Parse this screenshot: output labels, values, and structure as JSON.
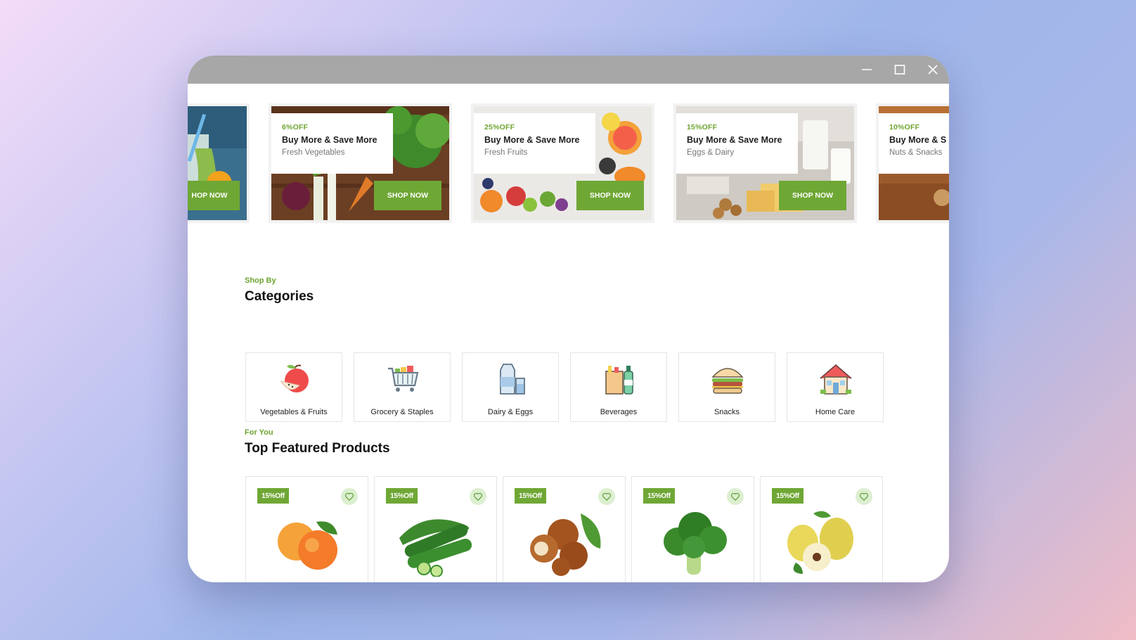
{
  "window": {
    "controls": {
      "minimize": "minimize-icon",
      "maximize": "maximize-icon",
      "close": "close-icon"
    }
  },
  "banners": [
    {
      "off": "",
      "title": "",
      "subtitle": "",
      "button": "SHOP NOW",
      "button_visible": "HOP NOW"
    },
    {
      "off": "6%OFF",
      "title": "Buy More & Save More",
      "subtitle": "Fresh Vegetables",
      "button": "SHOP NOW"
    },
    {
      "off": "25%OFF",
      "title": "Buy More & Save More",
      "subtitle": "Fresh Fruits",
      "button": "SHOP NOW"
    },
    {
      "off": "15%OFF",
      "title": "Buy More & Save More",
      "subtitle": "Eggs & Dairy",
      "button": "SHOP NOW"
    },
    {
      "off": "10%OFF",
      "title": "Buy More & S",
      "subtitle": "Nuts & Snacks",
      "button": ""
    }
  ],
  "categories_section": {
    "kicker": "Shop By",
    "title": "Categories",
    "items": [
      {
        "label": "Vegetables & Fruits",
        "icon": "apple-icon"
      },
      {
        "label": "Grocery & Staples",
        "icon": "shopping-cart-icon"
      },
      {
        "label": "Dairy & Eggs",
        "icon": "milk-icon"
      },
      {
        "label": "Beverages",
        "icon": "beverage-bag-icon"
      },
      {
        "label": "Snacks",
        "icon": "burger-icon"
      },
      {
        "label": "Home Care",
        "icon": "house-icon"
      }
    ]
  },
  "featured_section": {
    "kicker": "For You",
    "title": "Top Featured Products",
    "products": [
      {
        "badge": "15%Off",
        "image": "apricot-image"
      },
      {
        "badge": "15%Off",
        "image": "cucumber-image"
      },
      {
        "badge": "15%Off",
        "image": "hazelnut-image"
      },
      {
        "badge": "15%Off",
        "image": "broccoli-image"
      },
      {
        "badge": "15%Off",
        "image": "quince-image"
      }
    ]
  },
  "colors": {
    "accent": "#6fa735",
    "titlebar": "#a7a7a7",
    "fav_bg": "#dcefd0"
  }
}
